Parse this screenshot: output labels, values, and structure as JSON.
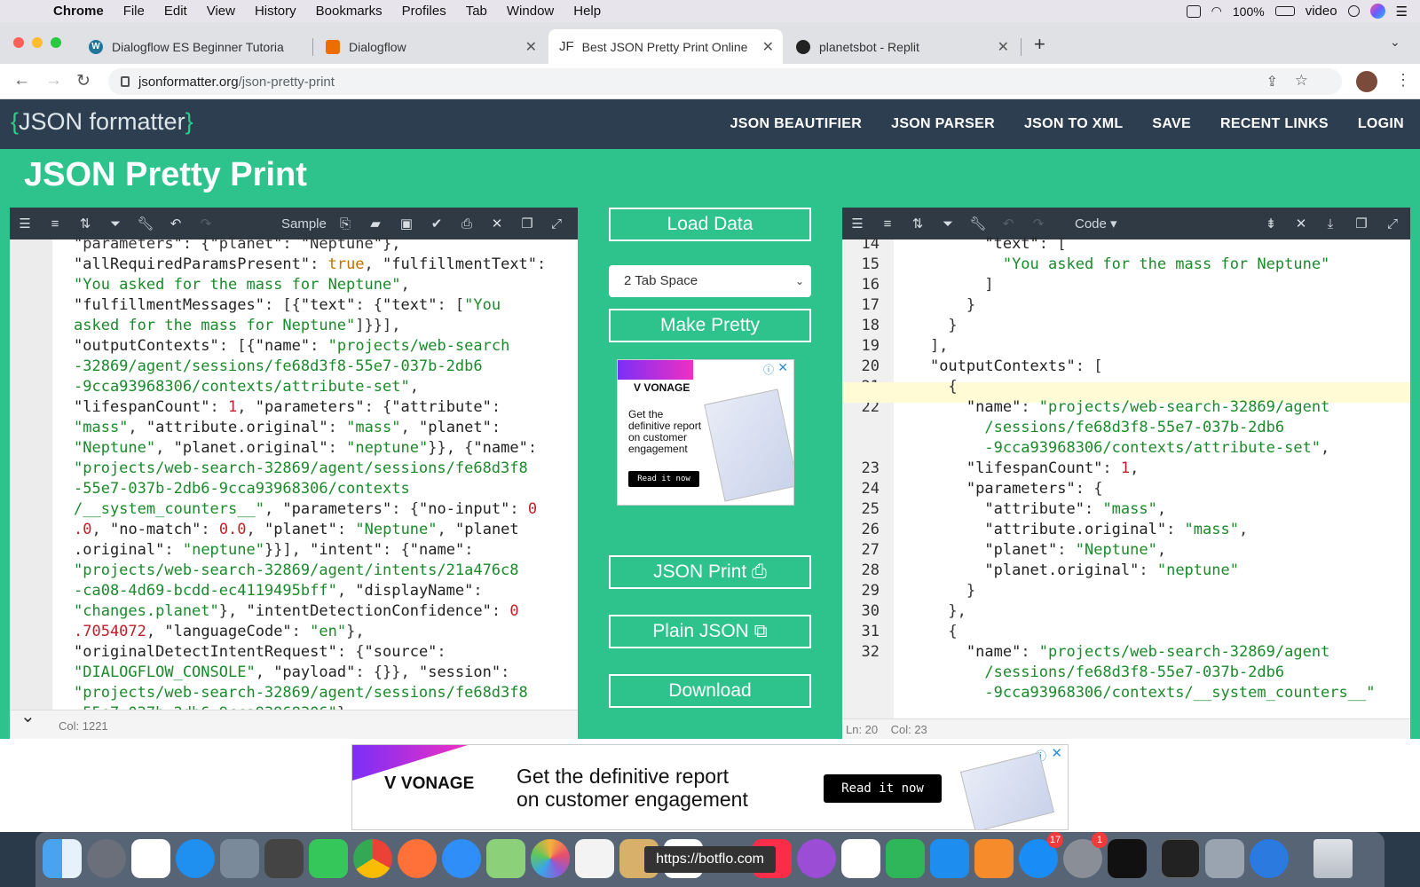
{
  "menubar": {
    "app": "Chrome",
    "items": [
      "File",
      "Edit",
      "View",
      "History",
      "Bookmarks",
      "Profiles",
      "Tab",
      "Window",
      "Help"
    ],
    "battery": "100%",
    "user": "video"
  },
  "tabs": [
    {
      "title": "Dialogflow ES Beginner Tutoria"
    },
    {
      "title": "Dialogflow"
    },
    {
      "title": "Best JSON Pretty Print Online",
      "favicon": "JF"
    },
    {
      "title": "planetsbot - Replit"
    }
  ],
  "address": {
    "host": "jsonformatter.org",
    "path": "/json-pretty-print"
  },
  "site": {
    "logo": "JSON formatter",
    "nav": [
      "JSON BEAUTIFIER",
      "JSON PARSER",
      "JSON TO XML",
      "SAVE",
      "RECENT LINKS",
      "LOGIN"
    ],
    "page_title": "JSON Pretty Print"
  },
  "left_editor": {
    "sample_label": "Sample",
    "status": "Col: 1221"
  },
  "right_editor": {
    "mode_label": "Code ▾",
    "status": "Ln: 20    Col: 23",
    "line_numbers": [
      "14",
      "15",
      "16",
      "17",
      "18",
      "19",
      "20",
      "21",
      "22",
      "",
      "",
      "23",
      "24",
      "25",
      "26",
      "27",
      "28",
      "29",
      "30",
      "31",
      "32",
      "",
      ""
    ]
  },
  "controls": {
    "load_data": "Load Data",
    "tab_space": "2 Tab Space",
    "make_pretty": "Make Pretty",
    "json_print": "JSON Print",
    "plain_json": "Plain JSON",
    "download": "Download"
  },
  "ad_small": {
    "brand": "VONAGE",
    "text": "Get the definitive report on customer engagement",
    "cta": "Read it now"
  },
  "ad_bottom": {
    "brand": "VONAGE",
    "line1": "Get the definitive report",
    "line2": "on customer engagement",
    "cta": "Read it now"
  },
  "dock": {
    "tooltip": "https://botflo.com",
    "badges": [
      "17",
      "1"
    ]
  },
  "colors": {
    "green": "#2ec28d",
    "header": "#2c3e50",
    "string": "#1a8a2a",
    "number": "#c0202a",
    "boolean": "#c07000"
  }
}
